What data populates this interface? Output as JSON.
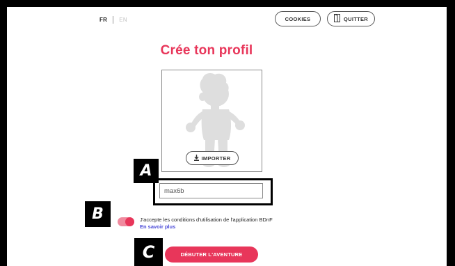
{
  "header": {
    "lang_fr": "FR",
    "lang_en": "EN",
    "cookies_label": "COOKIES",
    "quit_label": "QUITTER",
    "quit_icon": "door-exit-icon"
  },
  "main": {
    "title": "Crée ton profil",
    "avatar_icon": "avatar-placeholder-icon",
    "import_label": "IMPORTER",
    "import_icon": "download-icon",
    "username_value": "max6b",
    "terms_text": "J'accepte les conditions d'utilisation de l'application BDnF",
    "terms_link": "En savoir plus",
    "terms_toggle_on": true,
    "start_label": "DÉBUTER L'AVENTURE"
  },
  "annotations": {
    "a": "A",
    "b": "B",
    "c": "C"
  },
  "colors": {
    "accent": "#e8365a",
    "toggle_track": "#f08a9e",
    "link": "#4a4ad8",
    "avatar_gray": "#dedede",
    "frame_background": "#000000"
  }
}
